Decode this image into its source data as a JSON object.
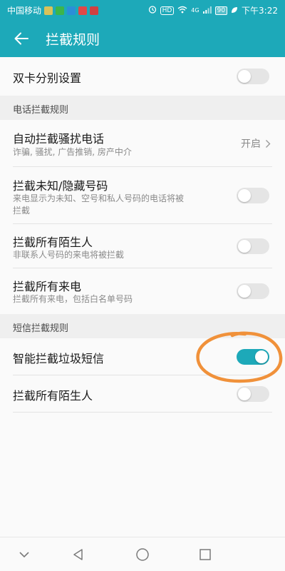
{
  "status_bar": {
    "carrier": "中国移动",
    "hd_label": "HD",
    "signal_label": "4G",
    "battery": "90",
    "time": "下午3:22"
  },
  "header": {
    "title": "拦截规则"
  },
  "rows": {
    "dual_sim": {
      "label": "双卡分别设置",
      "enabled": false
    },
    "spam_calls": {
      "label": "自动拦截骚扰电话",
      "description": "诈骗, 骚扰, 广告推销, 房产中介",
      "value": "开启"
    },
    "unknown_numbers": {
      "label": "拦截未知/隐藏号码",
      "description_line1": "来电显示为未知、空号和私人号码的电话将被",
      "description_line2": "拦截",
      "enabled": false
    },
    "strangers_calls": {
      "label": "拦截所有陌生人",
      "description": "非联系人号码的来电将被拦截",
      "enabled": false
    },
    "all_calls": {
      "label": "拦截所有来电",
      "description": "拦截所有来电，包括白名单号码",
      "enabled": false
    },
    "smart_sms": {
      "label": "智能拦截垃圾短信",
      "enabled": true
    },
    "strangers_sms": {
      "label": "拦截所有陌生人",
      "enabled": false
    }
  },
  "sections": {
    "call_rules": "电话拦截规则",
    "sms_rules": "短信拦截规则"
  },
  "nav": {
    "buttons": [
      "collapse",
      "back",
      "home",
      "recents"
    ]
  },
  "icons": {
    "back": "arrow-left-icon",
    "chevron": "chevron-right-icon"
  },
  "colors": {
    "accent": "#1da9b9",
    "annotation": "#f0913a"
  }
}
